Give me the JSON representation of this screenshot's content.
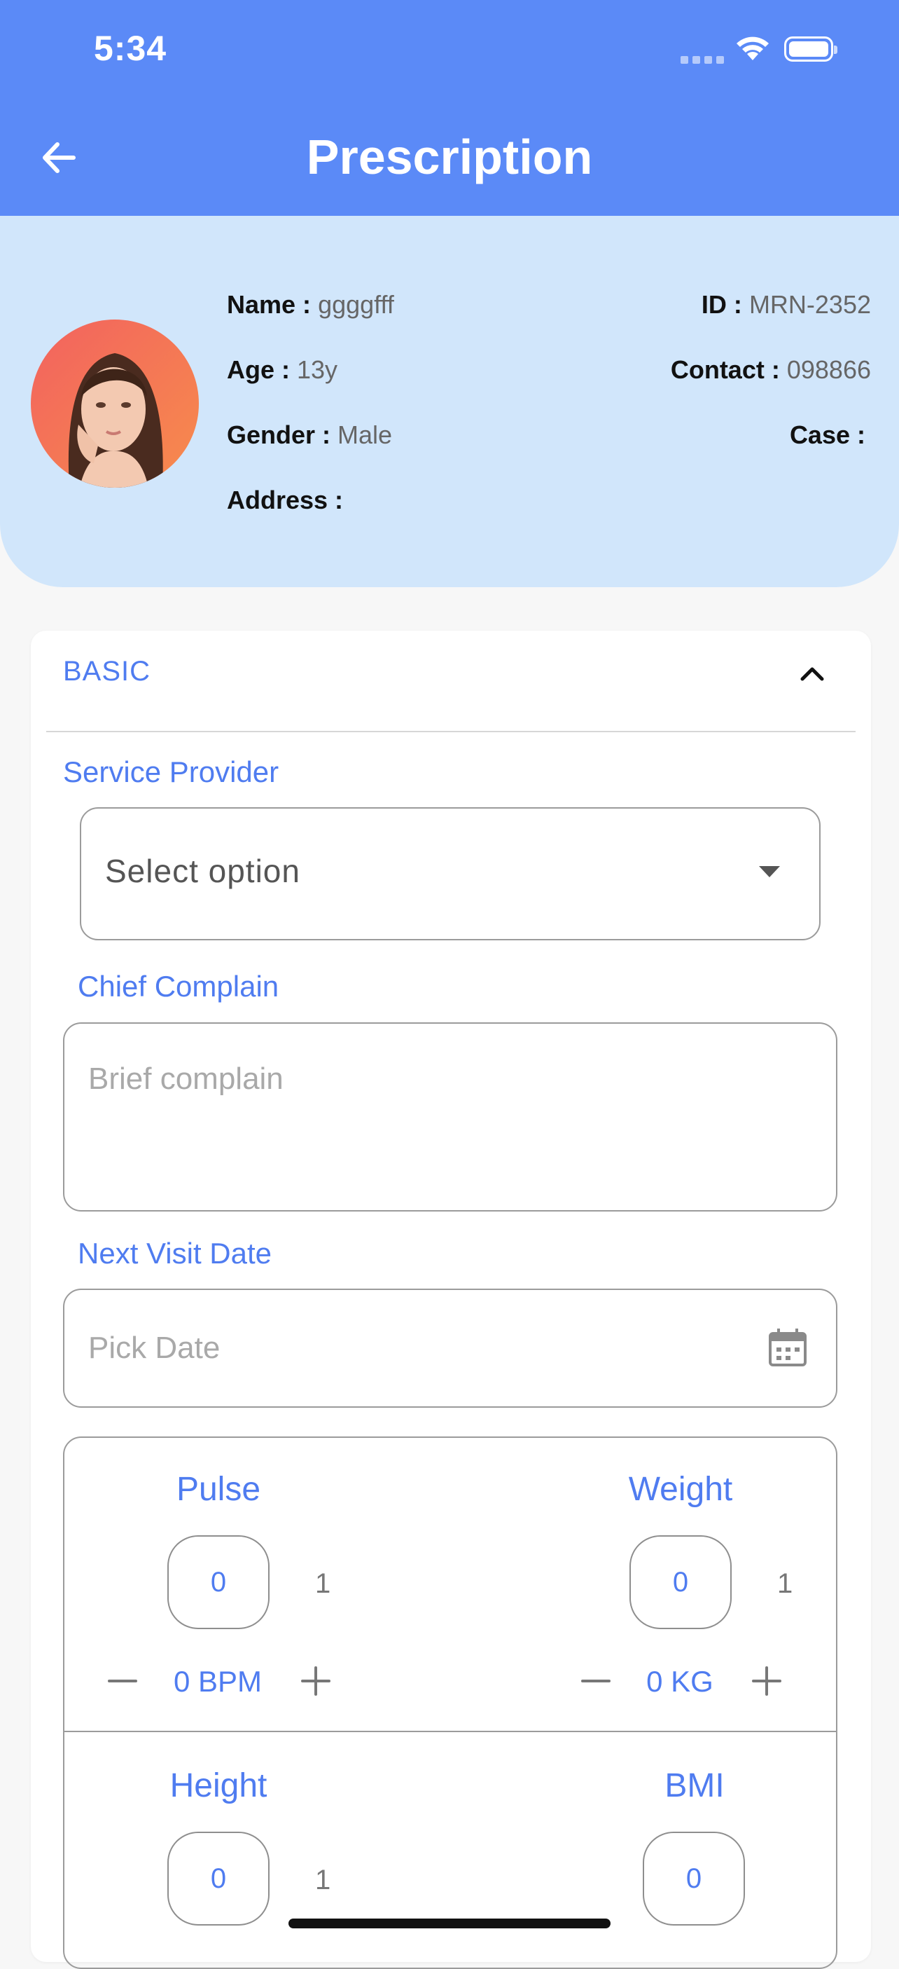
{
  "status_bar": {
    "time": "5:34"
  },
  "app_bar": {
    "title": "Prescription",
    "back_icon": "arrow-left-icon"
  },
  "patient": {
    "name_label": "Name :",
    "name": "ggggfff",
    "id_label": "ID :",
    "id": "MRN-2352",
    "age_label": "Age :",
    "age": "13y",
    "contact_label": "Contact :",
    "contact": "098866",
    "gender_label": "Gender :",
    "gender": "Male",
    "case_label": "Case :",
    "case": "",
    "address_label": "Address :",
    "address": ""
  },
  "basic_section": {
    "title": "BASIC",
    "service_provider": {
      "label": "Service Provider",
      "value": "Select option"
    },
    "chief_complain": {
      "label": "Chief Complain",
      "placeholder": "Brief complain"
    },
    "next_visit": {
      "label": "Next Visit Date",
      "placeholder": "Pick Date"
    }
  },
  "vitals": {
    "pulse": {
      "label": "Pulse",
      "value": "0",
      "step": "1",
      "unit_display": "0 BPM"
    },
    "weight": {
      "label": "Weight",
      "value": "0",
      "step": "1",
      "unit_display": "0 KG"
    },
    "height": {
      "label": "Height",
      "value": "0",
      "step": "1"
    },
    "bmi": {
      "label": "BMI",
      "value": "0"
    }
  },
  "colors": {
    "primary": "#5b8af7",
    "accent_text": "#4f7cf0",
    "header_bg": "#d1e6fb"
  }
}
